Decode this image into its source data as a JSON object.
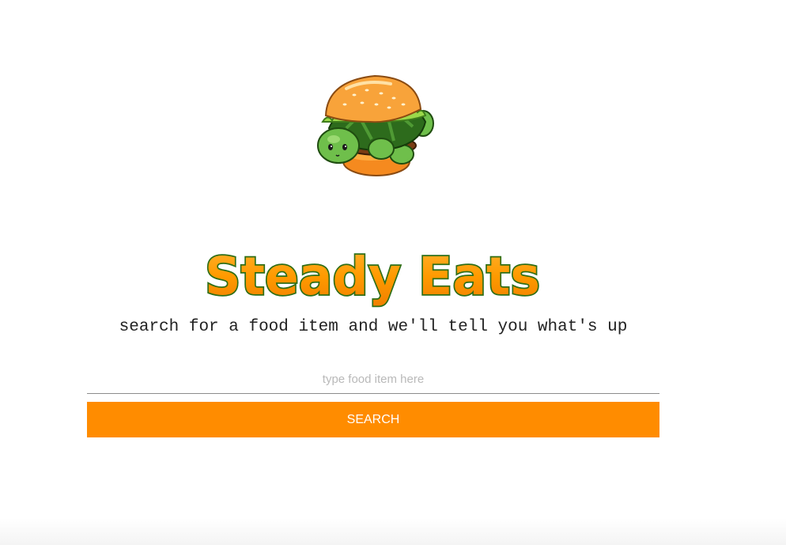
{
  "brand": {
    "title": "Steady Eats",
    "logo_icon": "turtle-burger-icon"
  },
  "tagline": "search for a food item and we'll tell you what's up",
  "search": {
    "placeholder": "type food item here",
    "value": "",
    "button_label": "SEARCH"
  },
  "colors": {
    "accent": "#ff8c00",
    "brand_green": "#2e7d1f",
    "brand_orange": "#ff9200"
  }
}
